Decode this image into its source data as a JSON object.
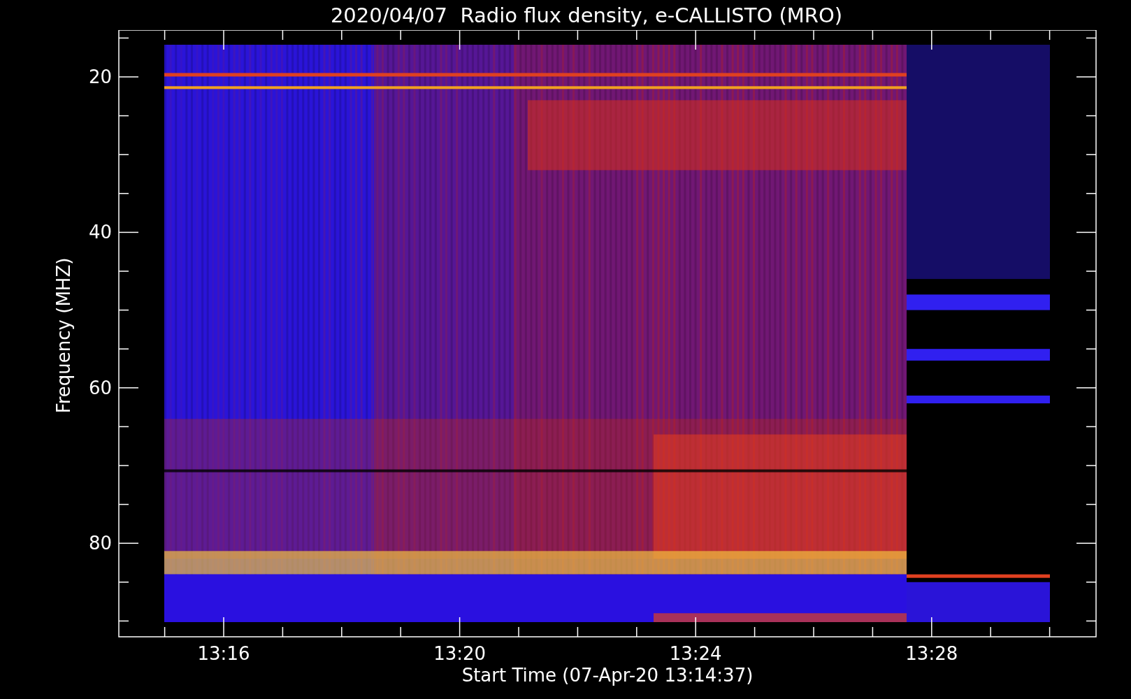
{
  "title": "2020/04/07  Radio flux density, e-CALLISTO (MRO)",
  "y_axis": {
    "label": "Frequency (MHZ)",
    "ticks": [
      "20",
      "40",
      "60",
      "80"
    ]
  },
  "x_axis": {
    "label": "Start Time (07-Apr-20 13:14:37)",
    "ticks": [
      "13:16",
      "13:20",
      "13:24",
      "13:28"
    ]
  }
}
